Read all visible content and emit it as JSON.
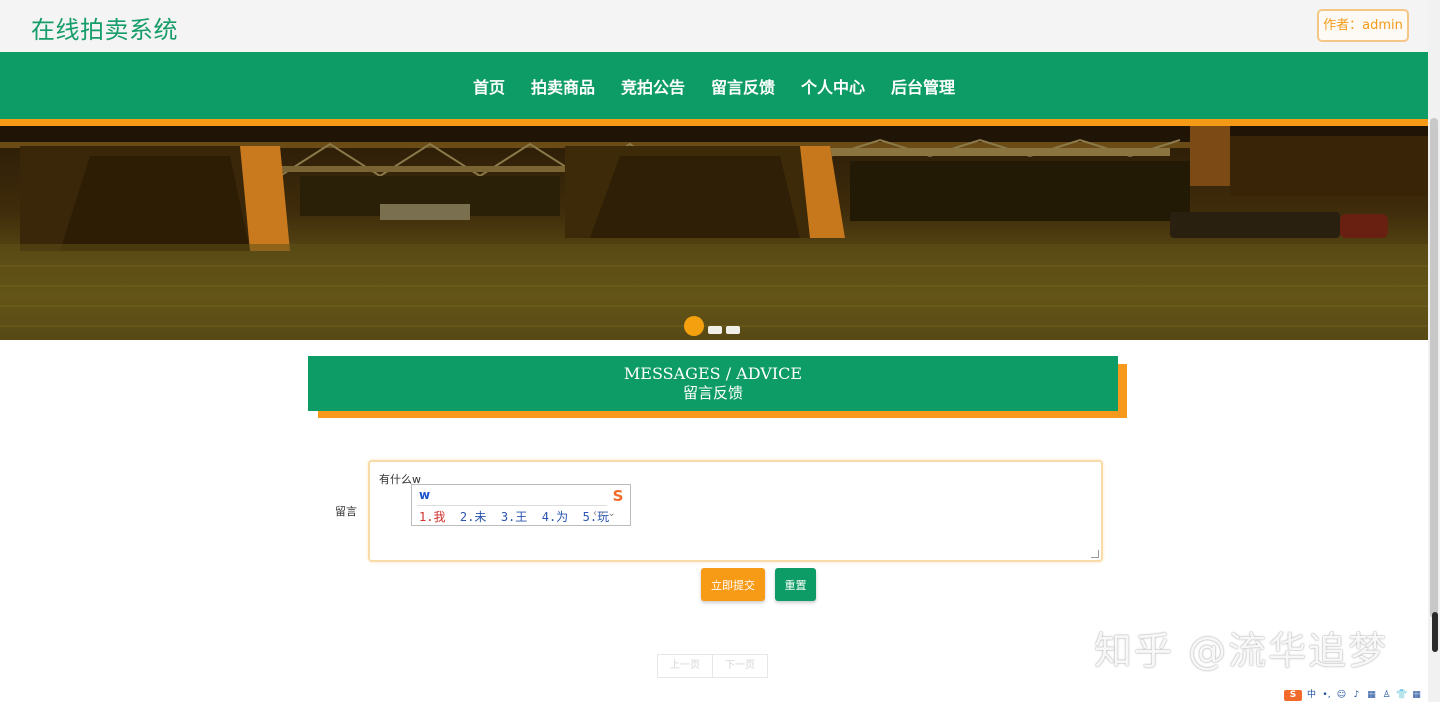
{
  "header": {
    "site_title": "在线拍卖系统",
    "author_label": "作者：admin"
  },
  "nav": {
    "items": [
      "首页",
      "拍卖商品",
      "竞拍公告",
      "留言反馈",
      "个人中心",
      "后台管理"
    ]
  },
  "banner": {
    "slide_count": 3,
    "active_slide": 1
  },
  "section": {
    "title_en": "MESSAGES / ADVICE",
    "title_cn": "留言反馈"
  },
  "form": {
    "label": "留言",
    "textarea_value": "有什么w"
  },
  "ime_popup": {
    "input": "w",
    "logo": "S",
    "candidates": [
      "1.我",
      "2.未",
      "3.王",
      "4.为",
      "5.玩"
    ],
    "arrows": "‹ › ⌄"
  },
  "buttons": {
    "submit": "立即提交",
    "reset": "重置"
  },
  "pager": {
    "prev": "上一页",
    "next": "下一页"
  },
  "watermark": "知乎 @流华追梦",
  "ime_toolbar": {
    "logo": "S",
    "mode": "中",
    "items": [
      "•,",
      "☺",
      "♪",
      "▦",
      "♙",
      "👕",
      "▦"
    ]
  },
  "colors": {
    "brand_green": "#0e9c66",
    "accent_orange": "#f79a16",
    "title_green": "#179d69"
  }
}
